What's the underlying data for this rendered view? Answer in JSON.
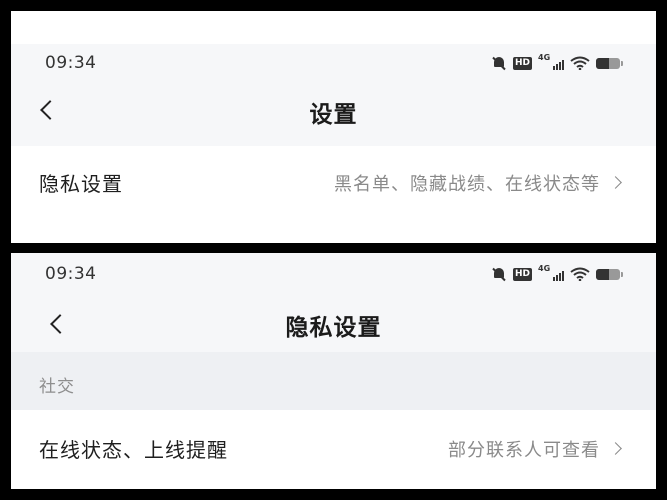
{
  "screen1": {
    "status": {
      "time": "09:34",
      "hd_label": "HD",
      "network_label": "4G"
    },
    "nav": {
      "title": "设置"
    },
    "row": {
      "label": "隐私设置",
      "value": "黑名单、隐藏战绩、在线状态等"
    }
  },
  "screen2": {
    "status": {
      "time": "09:34",
      "hd_label": "HD",
      "network_label": "4G"
    },
    "nav": {
      "title": "隐私设置"
    },
    "section": {
      "title": "社交"
    },
    "row": {
      "label": "在线状态、上线提醒",
      "value": "部分联系人可查看"
    }
  },
  "icons": [
    "bell-off-icon",
    "hd-icon",
    "signal-4g-icon",
    "wifi-icon",
    "battery-icon",
    "back-arrow-icon",
    "chevron-right-icon"
  ]
}
